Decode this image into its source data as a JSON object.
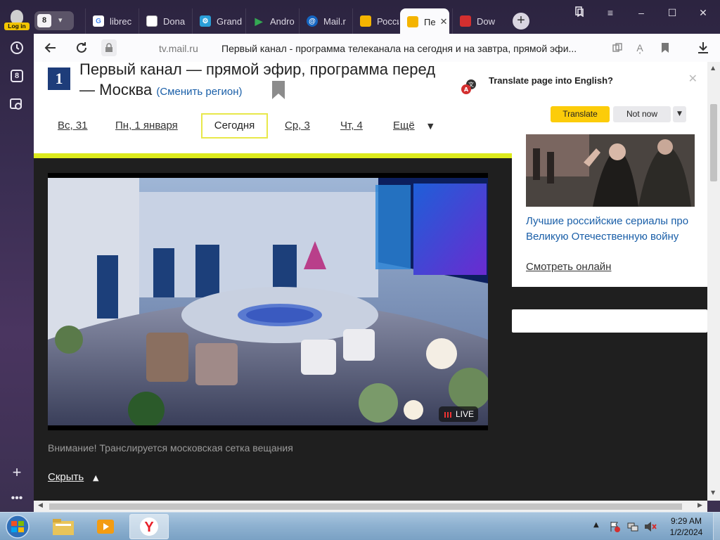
{
  "sidebar": {
    "login_label": "Log in",
    "tabs_count": "8"
  },
  "tabs": {
    "count": "8",
    "items": [
      {
        "label": "librec",
        "color": "#ffffff"
      },
      {
        "label": "Dona",
        "color": "#ffffff"
      },
      {
        "label": "Grand",
        "color": "#2a9fd8"
      },
      {
        "label": "Andro",
        "color": "#2d8d44"
      },
      {
        "label": "Mail.r",
        "color": "#1565c0"
      },
      {
        "label": "Росси",
        "color": "#f4b400"
      },
      {
        "label": "Пе",
        "color": "#f4b400"
      },
      {
        "label": "Dow",
        "color": "#d32f2f"
      }
    ]
  },
  "toolbar": {
    "url": "tv.mail.ru",
    "title": "Первый канал - программа телеканала на сегодня и на завтра, прямой эфи..."
  },
  "page": {
    "logo": "1",
    "heading_line1": "Первый канал — прямой эфир, программа перед",
    "heading_line2": "— Москва",
    "change_region": "(Сменить регион)",
    "days": [
      "Вс, 31",
      "Пн, 1 января",
      "Сегодня",
      "Ср, 3",
      "Чт, 4",
      "Ещё"
    ],
    "live_badge": "LIVE",
    "notice": "Внимание! Транслируется московская сетка вещания",
    "hide": "Скрыть"
  },
  "sidecard": {
    "title": "Лучшие российские сериалы про Великую Отечественную войну",
    "link": "Смотреть онлайн"
  },
  "translate": {
    "prompt": "Translate page into English?",
    "translate_button": "Translate",
    "not_now_button": "Not now"
  },
  "taskbar": {
    "time": "9:29 AM",
    "date": "1/2/2024"
  },
  "colors": {
    "accent_yellow": "#fccc0a",
    "link_blue": "#1a5fa8",
    "highlight_bar": "#dcea1c"
  }
}
